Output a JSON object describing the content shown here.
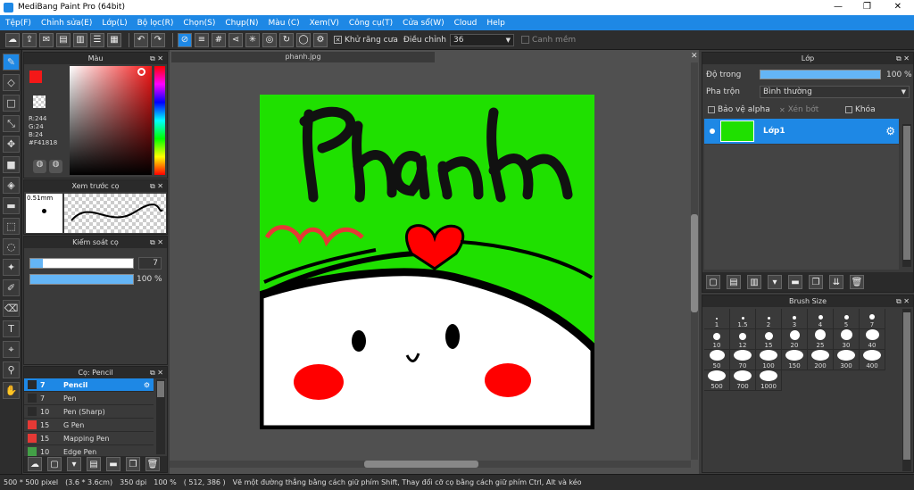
{
  "title": "MediBang Paint Pro (64bit)",
  "menu": [
    "Tệp(F)",
    "Chỉnh sửa(E)",
    "Lớp(L)",
    "Bộ lọc(R)",
    "Chọn(S)",
    "Chụp(N)",
    "Màu (C)",
    "Xem(V)",
    "Công cụ(T)",
    "Cửa sổ(W)",
    "Cloud",
    "Help"
  ],
  "toolbar": {
    "antialias": "Khử răng cưa",
    "adjust": "Điều chỉnh",
    "adjust_val": "36",
    "smooth": "Canh mềm"
  },
  "color_panel": {
    "title": "Màu",
    "r": "R:244",
    "g": "G:24",
    "b": "B:24",
    "hex": "#F41818",
    "color": "#F41818"
  },
  "preview_panel": {
    "title": "Xem trước cọ",
    "size": "0.51mm"
  },
  "brush_ctrl": {
    "title": "Kiểm soát cọ",
    "size": "7",
    "opacity": "100 %"
  },
  "brush_list": {
    "title": "Cọ: Pencil",
    "items": [
      {
        "size": "7",
        "name": "Pencil",
        "color": "#2a2a2a",
        "sel": true
      },
      {
        "size": "7",
        "name": "Pen",
        "color": "#2a2a2a"
      },
      {
        "size": "10",
        "name": "Pen (Sharp)",
        "color": "#2a2a2a"
      },
      {
        "size": "15",
        "name": "G Pen",
        "color": "#e53935"
      },
      {
        "size": "15",
        "name": "Mapping Pen",
        "color": "#e53935"
      },
      {
        "size": "10",
        "name": "Edge Pen",
        "color": "#43a047"
      }
    ]
  },
  "doc_tab": "phanh.jpg",
  "layer_panel": {
    "title": "Lớp",
    "opacity_label": "Độ trong",
    "opacity_val": "100 %",
    "blend_label": "Pha trộn",
    "blend_val": "Bình thường",
    "protect_alpha": "Bảo vệ alpha",
    "clip": "Xén bớt",
    "lock": "Khóa",
    "layer_name": "Lớp1"
  },
  "brush_size": {
    "title": "Brush Size",
    "sizes": [
      "1",
      "1.5",
      "2",
      "3",
      "4",
      "5",
      "7",
      "10",
      "12",
      "15",
      "20",
      "25",
      "30",
      "40",
      "50",
      "70",
      "100",
      "150",
      "200",
      "300",
      "400",
      "500",
      "700",
      "1000"
    ]
  },
  "status": {
    "dim": "500 * 500 pixel",
    "cm": "(3.6 * 3.6cm)",
    "dpi": "350 dpi",
    "zoom": "100 %",
    "coord": "( 512, 386 )",
    "hint": "Vẽ một đường thẳng bằng cách giữ phím Shift, Thay đổi cỡ cọ bằng cách giữ phím Ctrl, Alt và kéo"
  }
}
